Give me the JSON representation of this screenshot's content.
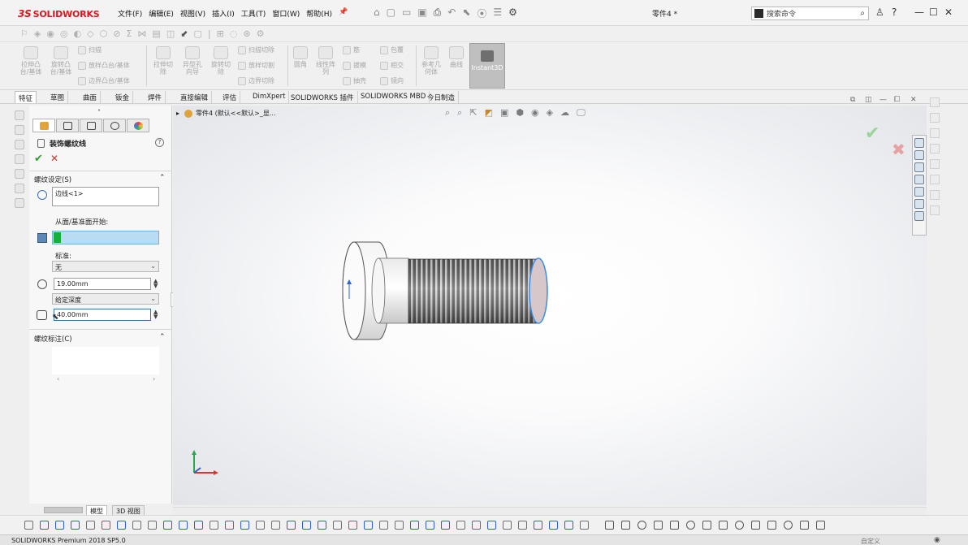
{
  "app": {
    "logo_text": "SOLIDWORKS",
    "logo_prefix": "3S",
    "document_title": "零件4 *"
  },
  "menu": [
    "文件(F)",
    "编辑(E)",
    "视图(V)",
    "插入(I)",
    "工具(T)",
    "窗口(W)",
    "帮助(H)"
  ],
  "search": {
    "placeholder": "搜索命令"
  },
  "window_controls": {
    "user": "♙",
    "help": "?",
    "minimize": "—",
    "maximize": "☐",
    "close": "✕"
  },
  "ribbon": {
    "extrude_boss": "拉伸凸\n台/基体",
    "revolve_boss": "旋转凸\n台/基体",
    "sweep": "扫描",
    "loft": "放样凸台/基体",
    "boundary": "边界凸台/基体",
    "extrude_cut": "拉伸切\n除",
    "hole_wizard": "异型孔\n向导",
    "revolve_cut": "旋转切\n除",
    "sweep_cut": "扫描切除",
    "loft_cut": "放样切割",
    "boundary_cut": "边界切除",
    "fillet": "圆角",
    "linear_pattern": "线性阵\n列",
    "rib": "筋",
    "draft": "拔模",
    "shell": "抽壳",
    "wrap": "包覆",
    "intersect": "相交",
    "mirror": "镜向",
    "ref_geometry": "参考几\n何体",
    "curves": "曲线",
    "instant3d": "Instant3D"
  },
  "tabs": [
    "特征",
    "草图",
    "曲面",
    "钣金",
    "焊件",
    "直接编辑",
    "评估",
    "DimXpert",
    "SOLIDWORKS 插件",
    "SOLIDWORKS MBD",
    "今日制造"
  ],
  "property_manager": {
    "title": "装饰螺纹线",
    "help": "?",
    "ok": "✔",
    "cancel": "✕",
    "thread_settings": {
      "title": "螺纹设定(S)",
      "edge_value": "边线<1>",
      "from_face_label": "从面/基准面开始:",
      "from_face_value": "",
      "standard_label": "标准:",
      "standard_value": "无",
      "diameter_value": "19.00mm",
      "end_condition": "给定深度",
      "depth_value": "40.00mm"
    },
    "thread_callout": {
      "title": "螺纹标注(C)"
    },
    "scroll_left": "‹",
    "scroll_right": "›"
  },
  "viewport": {
    "breadcrumb": "零件4  (默认<<默认>_显..."
  },
  "bottom_tabs": [
    "模型",
    "3D 视图"
  ],
  "status": {
    "product": "SOLIDWORKS Premium 2018 SP5.0",
    "right": "自定义"
  },
  "colors": {
    "accent_red": "#d71920",
    "ok_green": "#2f9e2f",
    "selection_blue": "#b9dcf2",
    "thread_dark": "#4a4a4a",
    "edge_highlight": "#3a8ee6"
  }
}
